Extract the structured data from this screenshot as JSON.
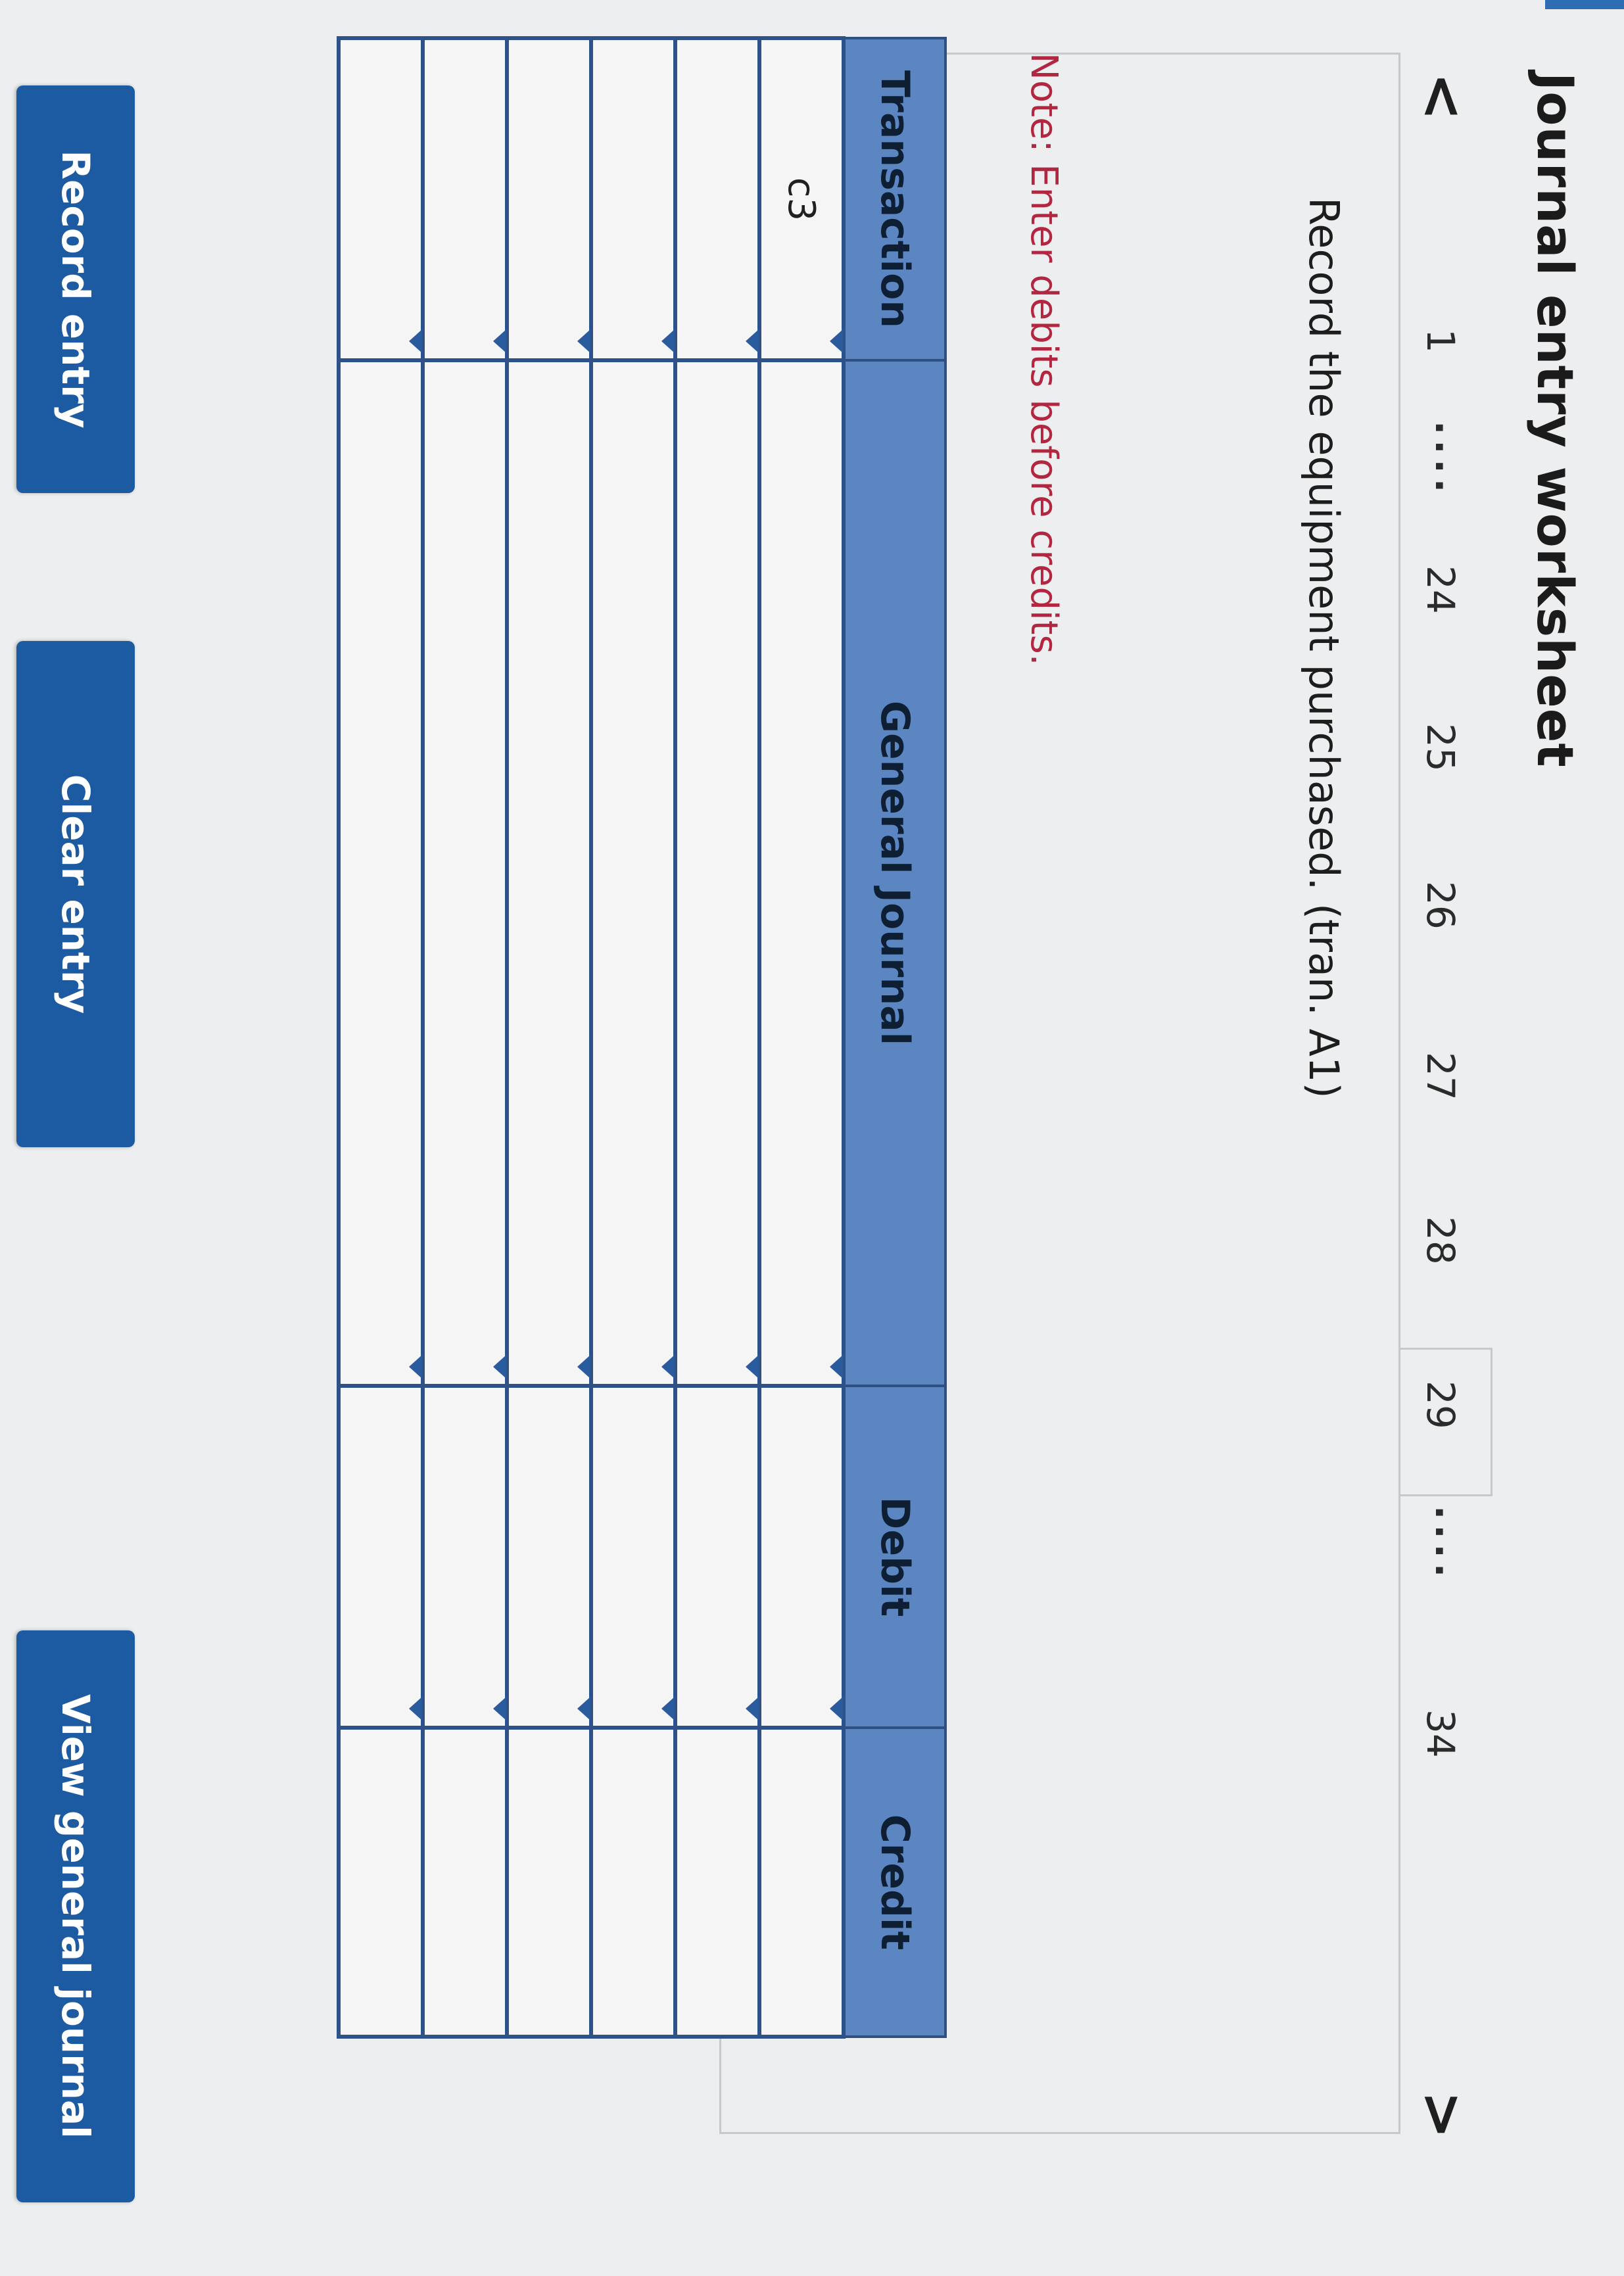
{
  "title": "Journal entry worksheet",
  "pager": {
    "prev": "<",
    "items": [
      "1",
      "24",
      "25",
      "26",
      "27",
      "28",
      "29",
      "34"
    ],
    "ellipsis": "....",
    "next": ">",
    "active": "29"
  },
  "prompt": "Record the equipment purchased. (tran. A1)",
  "note": "Note: Enter debits before credits.",
  "table": {
    "headers": [
      "Transaction",
      "General Journal",
      "Debit",
      "Credit"
    ],
    "rows": [
      [
        "c3",
        "",
        "",
        ""
      ],
      [
        "",
        "",
        "",
        ""
      ],
      [
        "",
        "",
        "",
        ""
      ],
      [
        "",
        "",
        "",
        ""
      ],
      [
        "",
        "",
        "",
        ""
      ],
      [
        "",
        "",
        "",
        ""
      ]
    ]
  },
  "buttons": {
    "record": "Record entry",
    "clear": "Clear entry",
    "view": "View general journal"
  }
}
